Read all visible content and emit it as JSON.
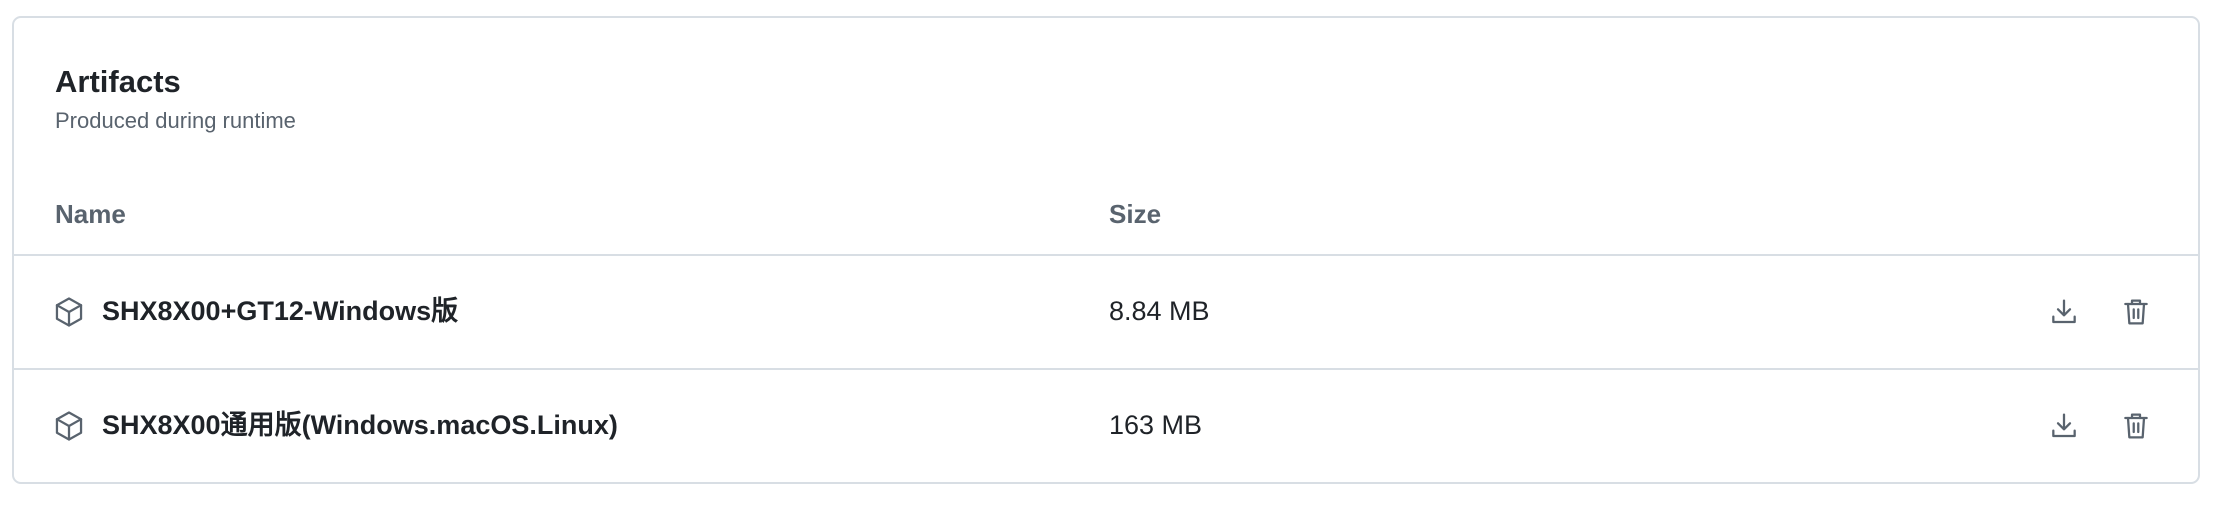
{
  "artifacts": {
    "title": "Artifacts",
    "subtitle": "Produced during runtime",
    "columns": {
      "name": "Name",
      "size": "Size"
    },
    "rows": [
      {
        "icon": "package-icon",
        "name": "SHX8X00+GT12-Windows版",
        "size": "8.84 MB",
        "actions": [
          "download-icon",
          "trash-icon"
        ]
      },
      {
        "icon": "package-icon",
        "name": "SHX8X00通用版(Windows.macOS.Linux)",
        "size": "163 MB",
        "actions": [
          "download-icon",
          "trash-icon"
        ]
      }
    ]
  },
  "colors": {
    "text_primary": "#1f2328",
    "text_muted": "#59636e",
    "border": "#d8dee4"
  }
}
